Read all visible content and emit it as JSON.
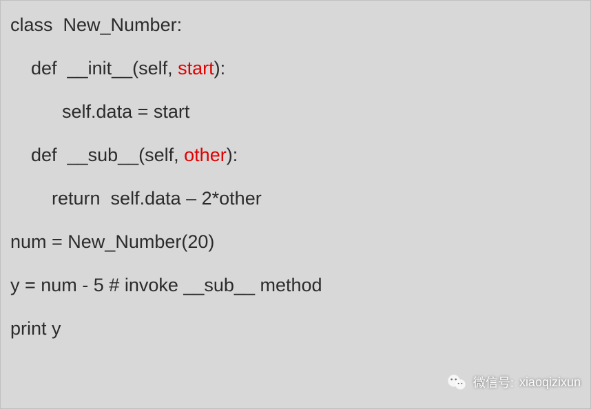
{
  "code": {
    "l1": {
      "a": "class  New_Number:"
    },
    "l2": {
      "a": "    def  __init__(self, ",
      "b": "start",
      "c": "):"
    },
    "l3": {
      "a": "          self.data = start"
    },
    "l4": {
      "a": "    def  __sub__(self, ",
      "b": "other",
      "c": "):"
    },
    "l5": {
      "a": "        return  self.data – 2*other"
    },
    "l6": {
      "a": "num = New_Number(20)"
    },
    "l7": {
      "a": "y = num - 5 # invoke __sub__ method"
    },
    "l8": {
      "a": "print y"
    }
  },
  "watermark": {
    "label": "微信号:",
    "account": "xiaoqizixun"
  }
}
